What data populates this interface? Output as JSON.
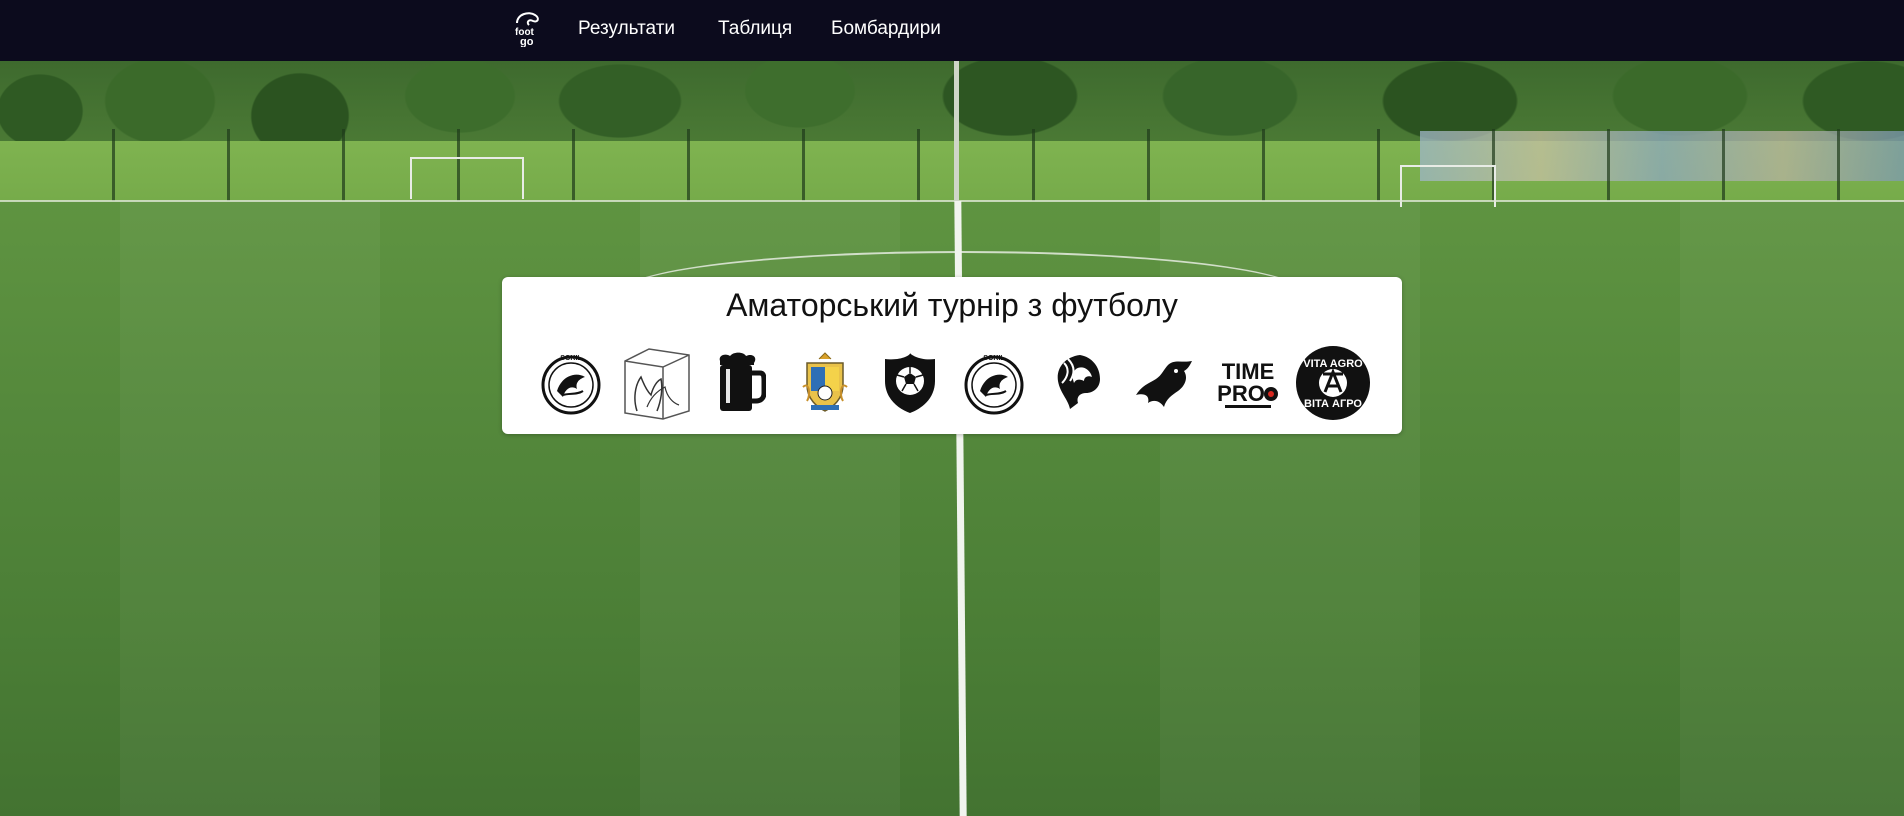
{
  "nav": {
    "brand_icon": "football-club-logo-icon",
    "items": [
      {
        "label": "Результати"
      },
      {
        "label": "Таблиця"
      },
      {
        "label": "Бомбардири"
      }
    ]
  },
  "hero": {
    "title": "Аматорський турнір з футболу",
    "teams": [
      {
        "icon": "sokil-falcon-logo-icon",
        "text": "SOKIL"
      },
      {
        "icon": "cube-hands-logo-icon"
      },
      {
        "icon": "beer-mug-logo-icon"
      },
      {
        "icon": "shield-crest-logo-icon"
      },
      {
        "icon": "ball-shield-logo-icon"
      },
      {
        "icon": "sokil-falcon-logo-icon",
        "text": "SOKIL"
      },
      {
        "icon": "lion-head-logo-icon"
      },
      {
        "icon": "dragon-head-logo-icon"
      },
      {
        "icon": "timepro-logo-icon",
        "text_top": "TIME",
        "text_bottom": "PRO"
      },
      {
        "icon": "vita-agro-logo-icon",
        "text_top": "VITA AGRO",
        "text_bottom": "ВІТА АГРО"
      }
    ]
  },
  "colors": {
    "navbar": "#0c0b1d",
    "pitch": "#55893c",
    "card": "#ffffff"
  }
}
